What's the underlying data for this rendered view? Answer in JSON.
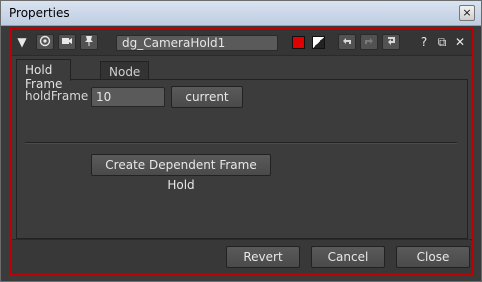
{
  "window": {
    "title": "Properties",
    "close_glyph": "×"
  },
  "toolbar": {
    "node_name": "dg_CameraHold1",
    "collapse_glyph": "▼",
    "help_glyph": "?",
    "float_glyph": "⧉",
    "close_glyph": "✕",
    "node_color": "#e00000"
  },
  "tabs": [
    {
      "label": "Hold Frame"
    },
    {
      "label": "Node"
    }
  ],
  "hold_frame": {
    "label": "holdFrame",
    "value": "10",
    "current_button": "current",
    "create_button": "Create Dependent Frame Hold"
  },
  "footer": {
    "revert": "Revert",
    "cancel": "Cancel",
    "close": "Close"
  }
}
